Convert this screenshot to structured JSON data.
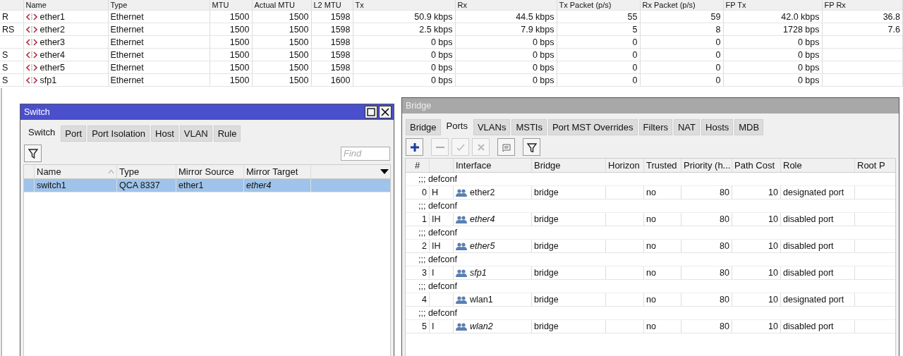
{
  "interfaces": {
    "columns": [
      "",
      "Name",
      "Type",
      "MTU",
      "Actual MTU",
      "L2 MTU",
      "Tx",
      "Rx",
      "Tx Packet (p/s)",
      "Rx Packet (p/s)",
      "FP Tx",
      "FP Rx"
    ],
    "rows": [
      {
        "flags": "R",
        "name": "ether1",
        "type": "Ethernet",
        "mtu": "1500",
        "actual_mtu": "1500",
        "l2_mtu": "1598",
        "tx": "50.9 kbps",
        "rx": "44.5 kbps",
        "tx_packet": "55",
        "rx_packet": "59",
        "fp_tx": "42.0 kbps",
        "fp_rx": "36.8"
      },
      {
        "flags": "RS",
        "name": "ether2",
        "type": "Ethernet",
        "mtu": "1500",
        "actual_mtu": "1500",
        "l2_mtu": "1598",
        "tx": "2.5 kbps",
        "rx": "7.9 kbps",
        "tx_packet": "5",
        "rx_packet": "8",
        "fp_tx": "1728 bps",
        "fp_rx": "7.6"
      },
      {
        "name": "ether3",
        "type": "Ethernet",
        "mtu": "1500",
        "actual_mtu": "1500",
        "l2_mtu": "1598",
        "tx": "0 bps",
        "rx": "0 bps",
        "tx_packet": "0",
        "rx_packet": "0",
        "fp_tx": "0 bps"
      },
      {
        "flags": "S",
        "name": "ether4",
        "type": "Ethernet",
        "mtu": "1500",
        "actual_mtu": "1500",
        "l2_mtu": "1598",
        "tx": "0 bps",
        "rx": "0 bps",
        "tx_packet": "0",
        "rx_packet": "0",
        "fp_tx": "0 bps"
      },
      {
        "flags": "S",
        "name": "ether5",
        "type": "Ethernet",
        "mtu": "1500",
        "actual_mtu": "1500",
        "l2_mtu": "1598",
        "tx": "0 bps",
        "rx": "0 bps",
        "tx_packet": "0",
        "rx_packet": "0",
        "fp_tx": "0 bps"
      },
      {
        "flags": "S",
        "name": "sfp1",
        "type": "Ethernet",
        "mtu": "1500",
        "actual_mtu": "1500",
        "l2_mtu": "1600",
        "tx": "0 bps",
        "rx": "0 bps",
        "tx_packet": "0",
        "rx_packet": "0",
        "fp_tx": "0 bps"
      }
    ]
  },
  "switch_window": {
    "title": "Switch",
    "active": true,
    "tabs": [
      {
        "label": "Switch",
        "selected": true
      },
      {
        "label": "Port",
        "selected": false
      },
      {
        "label": "Port Isolation",
        "selected": false
      },
      {
        "label": "Host",
        "selected": false
      },
      {
        "label": "VLAN",
        "selected": false
      },
      {
        "label": "Rule",
        "selected": false
      }
    ],
    "find": {
      "placeholder": "Find"
    },
    "columns": [
      "Name",
      "Type",
      "Mirror Source",
      "Mirror Target"
    ],
    "rows": [
      {
        "name": "switch1",
        "type": "QCA 8337",
        "mirror_source": "ether1",
        "mirror_target": "ether4",
        "target_inactive": true,
        "selected": true
      }
    ]
  },
  "bridge_window": {
    "title": "Bridge",
    "active": false,
    "tabs": [
      {
        "label": "Bridge",
        "selected": false
      },
      {
        "label": "Ports",
        "selected": true
      },
      {
        "label": "VLANs",
        "selected": false
      },
      {
        "label": "MSTIs",
        "selected": false
      },
      {
        "label": "Port MST Overrides",
        "selected": false
      },
      {
        "label": "Filters",
        "selected": false
      },
      {
        "label": "NAT",
        "selected": false
      },
      {
        "label": "Hosts",
        "selected": false
      },
      {
        "label": "MDB",
        "selected": false
      }
    ],
    "toolbar": [
      {
        "kind": "add",
        "disabled": false
      },
      {
        "kind": "remove",
        "disabled": true
      },
      {
        "kind": "enable",
        "disabled": true
      },
      {
        "kind": "disable",
        "disabled": true
      },
      {
        "kind": "comment",
        "disabled": false
      },
      {
        "kind": "filter",
        "disabled": false
      }
    ],
    "columns": [
      "#",
      "",
      "Interface",
      "Bridge",
      "Horizon",
      "Trusted",
      "Priority (h...",
      "Path Cost",
      "Role",
      "Root P"
    ],
    "rows": [
      {
        "comment": ";;; defconf",
        "number": "0",
        "flags": "H",
        "interface": "ether2",
        "inactive": false,
        "bridge": "bridge",
        "trusted": "no",
        "priority": "80",
        "path_cost": "10",
        "role": "designated port"
      },
      {
        "comment": ";;; defconf",
        "number": "1",
        "flags": "IH",
        "interface": "ether4",
        "inactive": true,
        "bridge": "bridge",
        "trusted": "no",
        "priority": "80",
        "path_cost": "10",
        "role": "disabled port"
      },
      {
        "comment": ";;; defconf",
        "number": "2",
        "flags": "IH",
        "interface": "ether5",
        "inactive": true,
        "bridge": "bridge",
        "trusted": "no",
        "priority": "80",
        "path_cost": "10",
        "role": "disabled port"
      },
      {
        "comment": ";;; defconf",
        "number": "3",
        "flags": "I",
        "interface": "sfp1",
        "inactive": true,
        "bridge": "bridge",
        "trusted": "no",
        "priority": "80",
        "path_cost": "10",
        "role": "disabled port"
      },
      {
        "comment": ";;; defconf",
        "number": "4",
        "interface": "wlan1",
        "inactive": false,
        "bridge": "bridge",
        "trusted": "no",
        "priority": "80",
        "path_cost": "10",
        "role": "designated port"
      },
      {
        "comment": ";;; defconf",
        "number": "5",
        "flags": "I",
        "interface": "wlan2",
        "inactive": true,
        "bridge": "bridge",
        "trusted": "no",
        "priority": "80",
        "path_cost": "10",
        "role": "disabled port"
      }
    ]
  }
}
